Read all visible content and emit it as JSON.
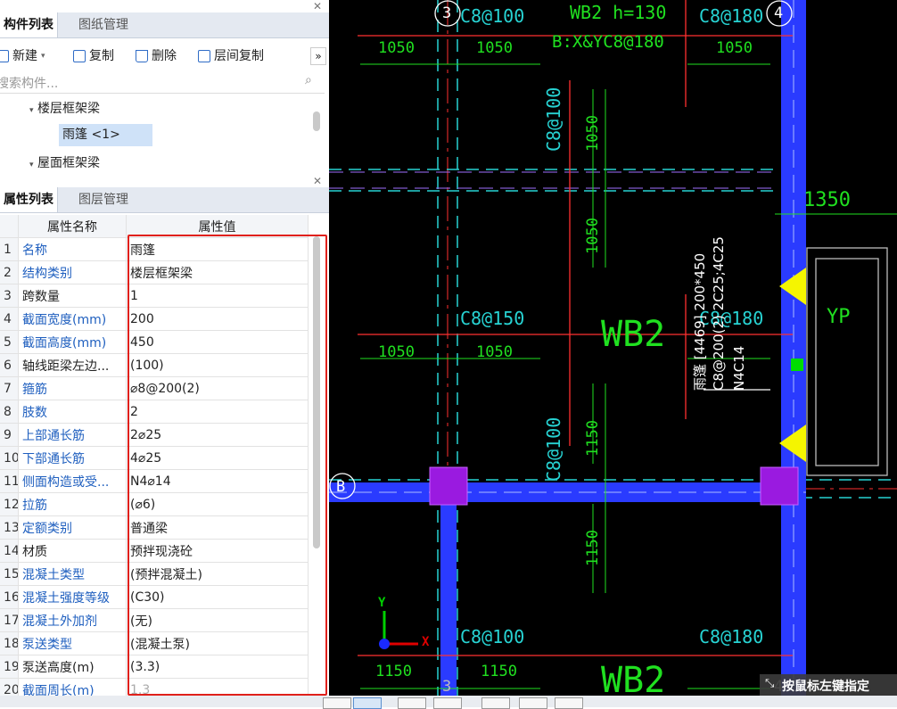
{
  "component_panel": {
    "tabs": [
      {
        "label": "构件列表",
        "active": true
      },
      {
        "label": "图纸管理",
        "active": false
      }
    ],
    "close_icon": "close-icon",
    "toolbar": {
      "new_label": "新建",
      "copy_label": "复制",
      "delete_label": "删除",
      "layer_copy_label": "层间复制",
      "more_label": "»"
    },
    "search_placeholder": "搜索构件...",
    "tree": [
      {
        "label": "楼层框架梁",
        "expanded": true
      },
      {
        "label": "雨篷 <1>",
        "selected": true
      },
      {
        "label": "屋面框架梁",
        "expanded": true
      }
    ]
  },
  "property_panel": {
    "tabs": [
      {
        "label": "属性列表",
        "active": true
      },
      {
        "label": "图层管理",
        "active": false
      }
    ],
    "columns": {
      "name": "属性名称",
      "value": "属性值"
    },
    "rows": [
      {
        "num": "1",
        "name": "名称",
        "value": "雨篷",
        "link": true
      },
      {
        "num": "2",
        "name": "结构类别",
        "value": "楼层框架梁",
        "link": true
      },
      {
        "num": "3",
        "name": "跨数量",
        "value": "1",
        "link": false
      },
      {
        "num": "4",
        "name": "截面宽度(mm)",
        "value": "200",
        "link": true
      },
      {
        "num": "5",
        "name": "截面高度(mm)",
        "value": "450",
        "link": true
      },
      {
        "num": "6",
        "name": "轴线距梁左边...",
        "value": "(100)",
        "link": false
      },
      {
        "num": "7",
        "name": "箍筋",
        "value": "⌀8@200(2)",
        "link": true
      },
      {
        "num": "8",
        "name": "肢数",
        "value": "2",
        "link": true
      },
      {
        "num": "9",
        "name": "上部通长筋",
        "value": "2⌀25",
        "link": true
      },
      {
        "num": "10",
        "name": "下部通长筋",
        "value": "4⌀25",
        "link": true
      },
      {
        "num": "11",
        "name": "侧面构造或受...",
        "value": "N4⌀14",
        "link": true
      },
      {
        "num": "12",
        "name": "拉筋",
        "value": "(⌀6)",
        "link": true
      },
      {
        "num": "13",
        "name": "定额类别",
        "value": "普通梁",
        "link": true
      },
      {
        "num": "14",
        "name": "材质",
        "value": "预拌现浇砼",
        "link": false
      },
      {
        "num": "15",
        "name": "混凝土类型",
        "value": "(预拌混凝土)",
        "link": true
      },
      {
        "num": "16",
        "name": "混凝土强度等级",
        "value": "(C30)",
        "link": true
      },
      {
        "num": "17",
        "name": "混凝土外加剂",
        "value": "(无)",
        "link": true
      },
      {
        "num": "18",
        "name": "泵送类型",
        "value": "(混凝土泵)",
        "link": true
      },
      {
        "num": "19",
        "name": "泵送高度(m)",
        "value": "(3.3)",
        "link": false
      },
      {
        "num": "20",
        "name": "截面周长(m)",
        "value": "1.3",
        "link": true
      }
    ]
  },
  "cad": {
    "axis_labels": [
      "3",
      "4",
      "B",
      "3",
      "4"
    ],
    "slab_labels": [
      "WB2 h=130",
      "B:X&YC8@180",
      "WB2",
      "WB2",
      "YP"
    ],
    "rebar_labels": [
      "C8@100",
      "C8@180",
      "C8@150",
      "C8@180",
      "C8@100",
      "C8@180",
      "C8@100",
      "C8@100"
    ],
    "dims_h": [
      "1050",
      "1050",
      "1050",
      "1050",
      "1050",
      "1350",
      "1150",
      "1150"
    ],
    "dims_v": [
      "1050",
      "1050",
      "1150",
      "1150"
    ],
    "beam_annotation": [
      "雨篷 [4469] 200*450",
      "C8@200(2) 2C25;4C25",
      "N4C14"
    ],
    "status_hint": "按鼠标左键指定",
    "ucs": {
      "x": "X",
      "y": "Y"
    }
  }
}
